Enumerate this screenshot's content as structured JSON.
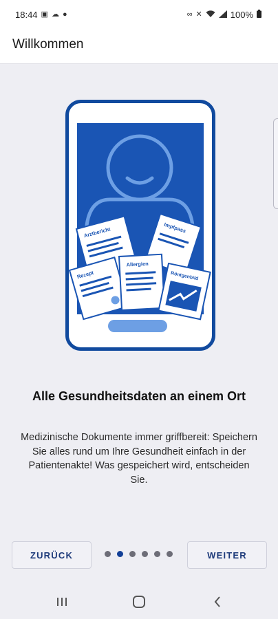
{
  "status_bar": {
    "time": "18:44",
    "battery": "100%"
  },
  "app_bar": {
    "title": "Willkommen"
  },
  "illustration": {
    "documents": [
      "Arztbericht",
      "Impfpass",
      "Rezept",
      "Allergien",
      "Röntgenbild"
    ],
    "colors": {
      "primary": "#1a55b4",
      "frame": "#114a9e",
      "accent_light": "#6d9fe4"
    }
  },
  "content": {
    "headline": "Alle Gesundheitsdaten an einem Ort",
    "description": "Medizinische Dokumente immer griffbereit: Speichern Sie alles rund um Ihre Gesundheit einfach in der Patientenakte! Was gespeichert wird, entscheiden Sie."
  },
  "pager": {
    "back_label": "ZURÜCK",
    "next_label": "WEITER",
    "current_page": 2,
    "total_pages": 6
  },
  "nav_bar": {
    "icons": [
      "recent-apps-icon",
      "home-icon",
      "back-icon"
    ]
  }
}
